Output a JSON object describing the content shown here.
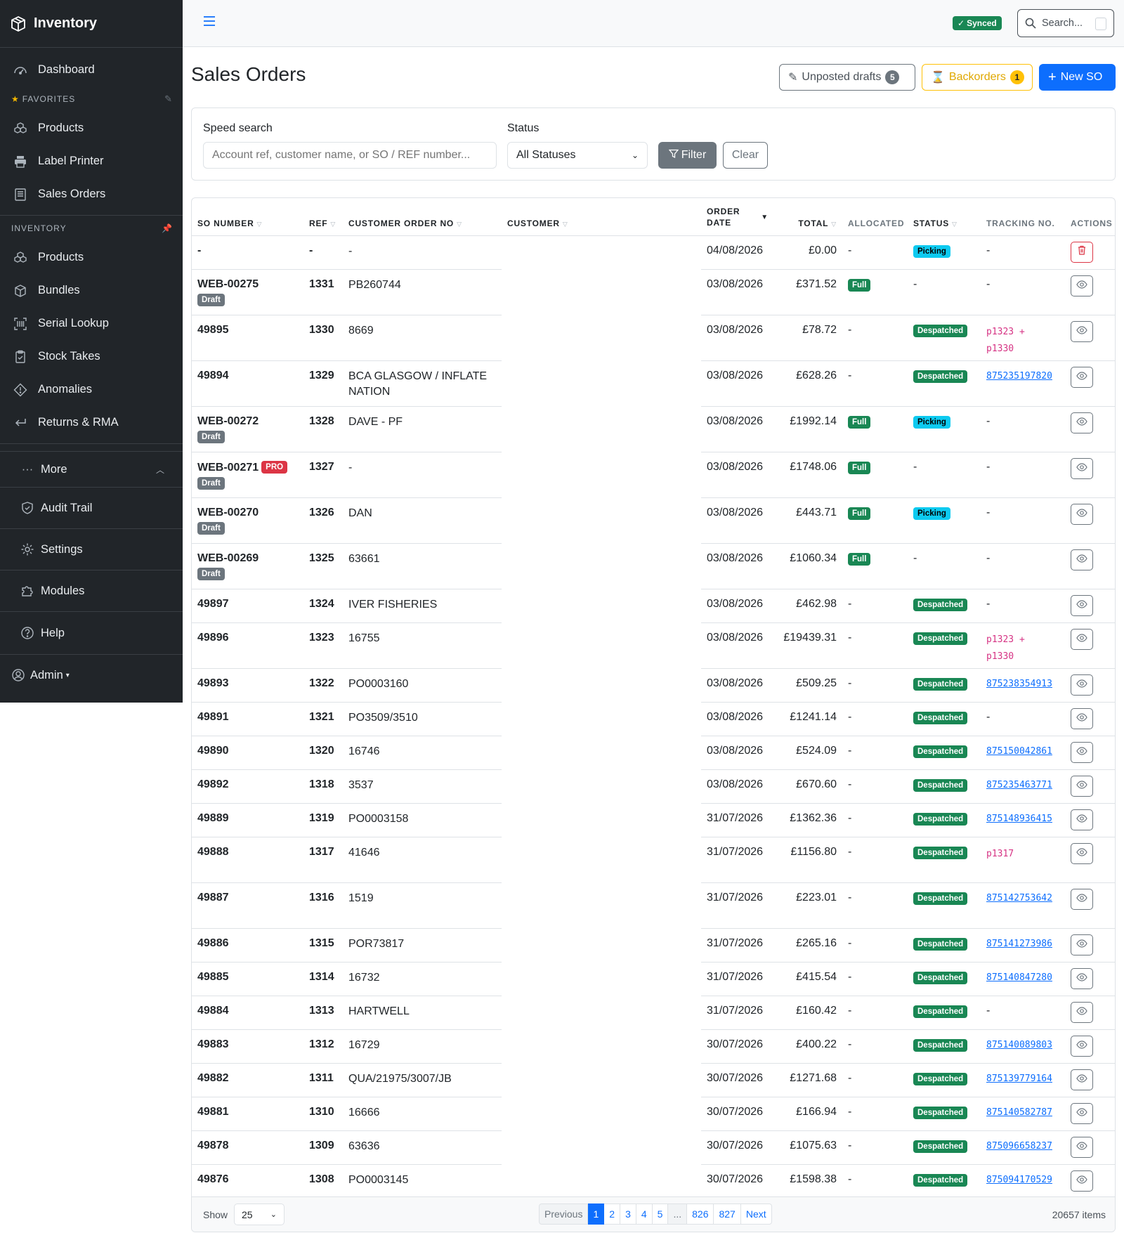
{
  "app": {
    "title": "Inventory"
  },
  "sidebar": {
    "dashboard": "Dashboard",
    "favorites_label": "FAVORITES",
    "favorites": [
      "Products",
      "Label Printer",
      "Sales Orders"
    ],
    "inventory_label": "INVENTORY",
    "inventory": [
      "Products",
      "Bundles",
      "Serial Lookup",
      "Stock Takes",
      "Anomalies",
      "Returns & RMA"
    ],
    "more": "More",
    "audit_trail": "Audit Trail",
    "settings": "Settings",
    "modules": "Modules",
    "help": "Help",
    "admin": "Admin"
  },
  "topbar": {
    "synced": "Synced",
    "search_placeholder": "Search..."
  },
  "page": {
    "title": "Sales Orders",
    "unposted_label": "Unposted drafts",
    "unposted_count": "5",
    "backorders_label": "Backorders",
    "backorders_count": "1",
    "new_label": "New SO"
  },
  "filters": {
    "speed_label": "Speed search",
    "speed_placeholder": "Account ref, customer name, or SO / REF number...",
    "status_label": "Status",
    "status_value": "All Statuses",
    "filter_btn": "Filter",
    "clear_btn": "Clear"
  },
  "table": {
    "headers": {
      "so": "SO NUMBER",
      "ref": "REF",
      "cust_order": "CUSTOMER ORDER NO",
      "customer": "CUSTOMER",
      "order_date_1": "ORDER",
      "order_date_2": "DATE",
      "total": "TOTAL",
      "allocated": "ALLOCATED",
      "status": "STATUS",
      "tracking": "TRACKING NO.",
      "actions": "ACTIONS"
    },
    "rows": [
      {
        "so": "-",
        "ref": "-",
        "cust": "-",
        "date": "04/08/2026",
        "total": "£0.00",
        "alloc": "-",
        "status": "Picking",
        "tracking": [
          "-"
        ],
        "tracking_type": "none",
        "action": "delete"
      },
      {
        "so": "WEB-00275",
        "draft": "Draft",
        "ref": "1331",
        "cust": "PB260744",
        "date": "03/08/2026",
        "total": "£371.52",
        "alloc": "Full",
        "status": "-",
        "tracking": [
          "-"
        ],
        "tracking_type": "none",
        "action": "view"
      },
      {
        "so": "49895",
        "ref": "1330",
        "cust": "8669",
        "date": "03/08/2026",
        "total": "£78.72",
        "alloc": "-",
        "status": "Despatched",
        "tracking": [
          "p1323 +",
          "p1330"
        ],
        "tracking_type": "code",
        "action": "view"
      },
      {
        "so": "49894",
        "ref": "1329",
        "cust": "BCA GLASGOW / INFLATE NATION",
        "date": "03/08/2026",
        "total": "£628.26",
        "alloc": "-",
        "status": "Despatched",
        "tracking": [
          "875235197820"
        ],
        "tracking_type": "link",
        "action": "view"
      },
      {
        "so": "WEB-00272",
        "draft": "Draft",
        "ref": "1328",
        "cust": "DAVE - PF",
        "date": "03/08/2026",
        "total": "£1992.14",
        "alloc": "Full",
        "status": "Picking",
        "tracking": [
          "-"
        ],
        "tracking_type": "none",
        "action": "view"
      },
      {
        "so": "WEB-00271",
        "pro": "PRO",
        "draft": "Draft",
        "ref": "1327",
        "cust": "-",
        "date": "03/08/2026",
        "total": "£1748.06",
        "alloc": "Full",
        "status": "-",
        "tracking": [
          "-"
        ],
        "tracking_type": "none",
        "action": "view"
      },
      {
        "so": "WEB-00270",
        "draft": "Draft",
        "ref": "1326",
        "cust": "DAN",
        "date": "03/08/2026",
        "total": "£443.71",
        "alloc": "Full",
        "status": "Picking",
        "tracking": [
          "-"
        ],
        "tracking_type": "none",
        "action": "view"
      },
      {
        "so": "WEB-00269",
        "draft": "Draft",
        "ref": "1325",
        "cust": "63661",
        "date": "03/08/2026",
        "total": "£1060.34",
        "alloc": "Full",
        "status": "-",
        "tracking": [
          "-"
        ],
        "tracking_type": "none",
        "action": "view"
      },
      {
        "so": "49897",
        "ref": "1324",
        "cust": "IVER FISHERIES",
        "date": "03/08/2026",
        "total": "£462.98",
        "alloc": "-",
        "status": "Despatched",
        "tracking": [
          "-"
        ],
        "tracking_type": "none",
        "action": "view"
      },
      {
        "so": "49896",
        "ref": "1323",
        "cust": "16755",
        "date": "03/08/2026",
        "total": "£19439.31",
        "alloc": "-",
        "status": "Despatched",
        "tracking": [
          "p1323 +",
          "p1330"
        ],
        "tracking_type": "code",
        "action": "view"
      },
      {
        "so": "49893",
        "ref": "1322",
        "cust": "PO0003160",
        "date": "03/08/2026",
        "total": "£509.25",
        "alloc": "-",
        "status": "Despatched",
        "tracking": [
          "875238354913"
        ],
        "tracking_type": "link",
        "action": "view"
      },
      {
        "so": "49891",
        "ref": "1321",
        "cust": "PO3509/3510",
        "date": "03/08/2026",
        "total": "£1241.14",
        "alloc": "-",
        "status": "Despatched",
        "tracking": [
          "-"
        ],
        "tracking_type": "none",
        "action": "view"
      },
      {
        "so": "49890",
        "ref": "1320",
        "cust": "16746",
        "date": "03/08/2026",
        "total": "£524.09",
        "alloc": "-",
        "status": "Despatched",
        "tracking": [
          "875150042861"
        ],
        "tracking_type": "link",
        "action": "view"
      },
      {
        "so": "49892",
        "ref": "1318",
        "cust": "3537",
        "date": "03/08/2026",
        "total": "£670.60",
        "alloc": "-",
        "status": "Despatched",
        "tracking": [
          "875235463771"
        ],
        "tracking_type": "link",
        "action": "view"
      },
      {
        "so": "49889",
        "ref": "1319",
        "cust": "PO0003158",
        "date": "31/07/2026",
        "total": "£1362.36",
        "alloc": "-",
        "status": "Despatched",
        "tracking": [
          "875148936415"
        ],
        "tracking_type": "link",
        "action": "view"
      },
      {
        "so": "49888",
        "ref": "1317",
        "cust": "41646",
        "date": "31/07/2026",
        "total": "£1156.80",
        "alloc": "-",
        "status": "Despatched",
        "tracking": [
          "p1317"
        ],
        "tracking_type": "code",
        "tall": true,
        "action": "view"
      },
      {
        "so": "49887",
        "ref": "1316",
        "cust": "1519",
        "date": "31/07/2026",
        "total": "£223.01",
        "alloc": "-",
        "status": "Despatched",
        "tracking": [
          "875142753642"
        ],
        "tracking_type": "link",
        "tall": true,
        "action": "view"
      },
      {
        "so": "49886",
        "ref": "1315",
        "cust": "POR73817",
        "date": "31/07/2026",
        "total": "£265.16",
        "alloc": "-",
        "status": "Despatched",
        "tracking": [
          "875141273986"
        ],
        "tracking_type": "link",
        "action": "view"
      },
      {
        "so": "49885",
        "ref": "1314",
        "cust": "16732",
        "date": "31/07/2026",
        "total": "£415.54",
        "alloc": "-",
        "status": "Despatched",
        "tracking": [
          "875140847280"
        ],
        "tracking_type": "link",
        "action": "view"
      },
      {
        "so": "49884",
        "ref": "1313",
        "cust": "HARTWELL",
        "date": "31/07/2026",
        "total": "£160.42",
        "alloc": "-",
        "status": "Despatched",
        "tracking": [
          "-"
        ],
        "tracking_type": "none",
        "action": "view"
      },
      {
        "so": "49883",
        "ref": "1312",
        "cust": "16729",
        "date": "30/07/2026",
        "total": "£400.22",
        "alloc": "-",
        "status": "Despatched",
        "tracking": [
          "875140089803"
        ],
        "tracking_type": "link",
        "action": "view"
      },
      {
        "so": "49882",
        "ref": "1311",
        "cust": "QUA/21975/3007/JB",
        "date": "30/07/2026",
        "total": "£1271.68",
        "alloc": "-",
        "status": "Despatched",
        "tracking": [
          "875139779164"
        ],
        "tracking_type": "link",
        "action": "view"
      },
      {
        "so": "49881",
        "ref": "1310",
        "cust": "16666",
        "date": "30/07/2026",
        "total": "£166.94",
        "alloc": "-",
        "status": "Despatched",
        "tracking": [
          "875140582787"
        ],
        "tracking_type": "link",
        "action": "view"
      },
      {
        "so": "49878",
        "ref": "1309",
        "cust": "63636",
        "date": "30/07/2026",
        "total": "£1075.63",
        "alloc": "-",
        "status": "Despatched",
        "tracking": [
          "875096658237"
        ],
        "tracking_type": "link",
        "action": "view"
      },
      {
        "so": "49876",
        "ref": "1308",
        "cust": "PO0003145",
        "date": "30/07/2026",
        "total": "£1598.38",
        "alloc": "-",
        "status": "Despatched",
        "tracking": [
          "875094170529"
        ],
        "tracking_type": "link",
        "action": "view"
      }
    ]
  },
  "footer": {
    "show_label": "Show",
    "page_size": "25",
    "pages": [
      "Previous",
      "1",
      "2",
      "3",
      "4",
      "5",
      "...",
      "826",
      "827",
      "Next"
    ],
    "active_page": "1",
    "items": "20657 items"
  },
  "colors": {
    "primary": "#0d6efd",
    "success": "#198754",
    "info": "#0dcaf0",
    "danger": "#dc3545",
    "warning": "#ffc107",
    "sidebar": "#212529"
  }
}
